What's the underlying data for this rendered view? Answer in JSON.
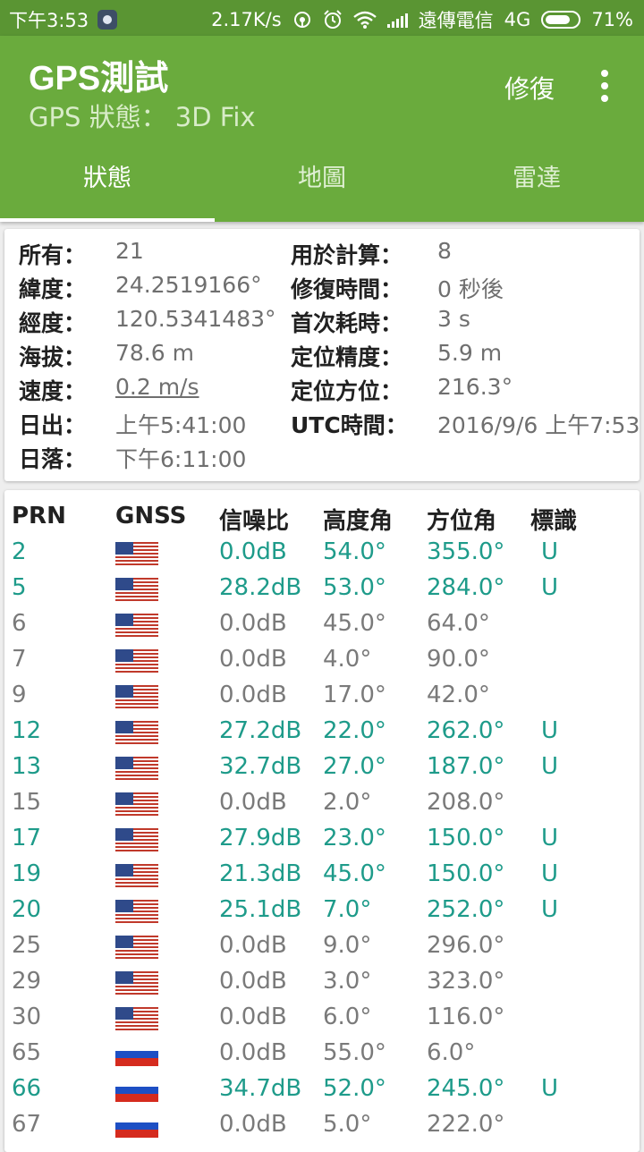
{
  "status_bar": {
    "time": "下午3:53",
    "speed": "2.17K/s",
    "carrier": "遠傳電信",
    "network": "4G",
    "battery": "71%",
    "icons": [
      "app-notification-icon",
      "hotspot-icon",
      "alarm-icon",
      "wifi-icon",
      "signal-icon",
      "battery-icon"
    ]
  },
  "app": {
    "title": "GPS測試",
    "subtitle": "GPS 狀態： 3D Fix",
    "fix_button": "修復",
    "colors": {
      "appbar": "#6aab3d",
      "statusbar": "#5a9533",
      "used_satellite": "#1e9b8a"
    }
  },
  "tabs": [
    {
      "label": "狀態",
      "active": true
    },
    {
      "label": "地圖",
      "active": false
    },
    {
      "label": "雷達",
      "active": false
    }
  ],
  "status_left": [
    {
      "label": "所有：",
      "value": "21"
    },
    {
      "label": "緯度：",
      "value": "24.2519166°"
    },
    {
      "label": "經度：",
      "value": "120.5341483°"
    },
    {
      "label": "海拔：",
      "value": "78.6 m"
    },
    {
      "label": "速度：",
      "value": "0.2 m/s"
    },
    {
      "label": "日出：",
      "value": "上午5:41:00"
    },
    {
      "label": "日落：",
      "value": "下午6:11:00"
    }
  ],
  "status_right": [
    {
      "label": "用於計算：",
      "value": "8"
    },
    {
      "label": "修復時間：",
      "value": "0 秒後"
    },
    {
      "label": "首次耗時：",
      "value": "3 s"
    },
    {
      "label": "定位精度：",
      "value": "5.9 m"
    },
    {
      "label": "定位方位：",
      "value": "216.3°"
    },
    {
      "label": "UTC時間：",
      "value": "2016/9/6 上午7:53"
    }
  ],
  "table": {
    "headers": [
      "PRN",
      "GNSS",
      "信噪比",
      "高度角",
      "方位角",
      "標識"
    ],
    "rows": [
      {
        "prn": "2",
        "gnss": "us-flag-icon",
        "snr": "0.0dB",
        "elev": "54.0°",
        "azim": "355.0°",
        "flag": "U",
        "used": true
      },
      {
        "prn": "5",
        "gnss": "us-flag-icon",
        "snr": "28.2dB",
        "elev": "53.0°",
        "azim": "284.0°",
        "flag": "U",
        "used": true
      },
      {
        "prn": "6",
        "gnss": "us-flag-icon",
        "snr": "0.0dB",
        "elev": "45.0°",
        "azim": "64.0°",
        "flag": "",
        "used": false
      },
      {
        "prn": "7",
        "gnss": "us-flag-icon",
        "snr": "0.0dB",
        "elev": "4.0°",
        "azim": "90.0°",
        "flag": "",
        "used": false
      },
      {
        "prn": "9",
        "gnss": "us-flag-icon",
        "snr": "0.0dB",
        "elev": "17.0°",
        "azim": "42.0°",
        "flag": "",
        "used": false
      },
      {
        "prn": "12",
        "gnss": "us-flag-icon",
        "snr": "27.2dB",
        "elev": "22.0°",
        "azim": "262.0°",
        "flag": "U",
        "used": true
      },
      {
        "prn": "13",
        "gnss": "us-flag-icon",
        "snr": "32.7dB",
        "elev": "27.0°",
        "azim": "187.0°",
        "flag": "U",
        "used": true
      },
      {
        "prn": "15",
        "gnss": "us-flag-icon",
        "snr": "0.0dB",
        "elev": "2.0°",
        "azim": "208.0°",
        "flag": "",
        "used": false
      },
      {
        "prn": "17",
        "gnss": "us-flag-icon",
        "snr": "27.9dB",
        "elev": "23.0°",
        "azim": "150.0°",
        "flag": "U",
        "used": true
      },
      {
        "prn": "19",
        "gnss": "us-flag-icon",
        "snr": "21.3dB",
        "elev": "45.0°",
        "azim": "150.0°",
        "flag": "U",
        "used": true
      },
      {
        "prn": "20",
        "gnss": "us-flag-icon",
        "snr": "25.1dB",
        "elev": "7.0°",
        "azim": "252.0°",
        "flag": "U",
        "used": true
      },
      {
        "prn": "25",
        "gnss": "us-flag-icon",
        "snr": "0.0dB",
        "elev": "9.0°",
        "azim": "296.0°",
        "flag": "",
        "used": false
      },
      {
        "prn": "29",
        "gnss": "us-flag-icon",
        "snr": "0.0dB",
        "elev": "3.0°",
        "azim": "323.0°",
        "flag": "",
        "used": false
      },
      {
        "prn": "30",
        "gnss": "us-flag-icon",
        "snr": "0.0dB",
        "elev": "6.0°",
        "azim": "116.0°",
        "flag": "",
        "used": false
      },
      {
        "prn": "65",
        "gnss": "russia-flag-icon",
        "snr": "0.0dB",
        "elev": "55.0°",
        "azim": "6.0°",
        "flag": "",
        "used": false
      },
      {
        "prn": "66",
        "gnss": "russia-flag-icon",
        "snr": "34.7dB",
        "elev": "52.0°",
        "azim": "245.0°",
        "flag": "U",
        "used": true
      },
      {
        "prn": "67",
        "gnss": "russia-flag-icon",
        "snr": "0.0dB",
        "elev": "5.0°",
        "azim": "222.0°",
        "flag": "",
        "used": false
      }
    ]
  }
}
